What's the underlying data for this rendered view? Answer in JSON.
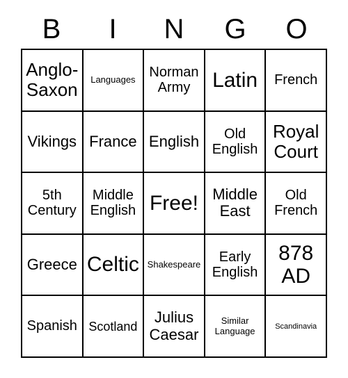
{
  "header": {
    "letters": [
      "B",
      "I",
      "N",
      "G",
      "O"
    ]
  },
  "grid": {
    "rows": [
      [
        {
          "text": "Anglo-Saxon",
          "size": "fs-xl"
        },
        {
          "text": "Languages",
          "size": "fs-xs"
        },
        {
          "text": "Norman Army",
          "size": "fs-md"
        },
        {
          "text": "Latin",
          "size": "fs-xxl"
        },
        {
          "text": "French",
          "size": "fs-md"
        }
      ],
      [
        {
          "text": "Vikings",
          "size": "fs-lg"
        },
        {
          "text": "France",
          "size": "fs-lg"
        },
        {
          "text": "English",
          "size": "fs-lg"
        },
        {
          "text": "Old English",
          "size": "fs-md"
        },
        {
          "text": "Royal Court",
          "size": "fs-xl"
        }
      ],
      [
        {
          "text": "5th Century",
          "size": "fs-md"
        },
        {
          "text": "Middle English",
          "size": "fs-md"
        },
        {
          "text": "Free!",
          "size": "fs-xxl"
        },
        {
          "text": "Middle East",
          "size": "fs-lg"
        },
        {
          "text": "Old French",
          "size": "fs-md"
        }
      ],
      [
        {
          "text": "Greece",
          "size": "fs-lg"
        },
        {
          "text": "Celtic",
          "size": "fs-xxl"
        },
        {
          "text": "Shakespeare",
          "size": "fs-xs"
        },
        {
          "text": "Early English",
          "size": "fs-md"
        },
        {
          "text": "878 AD",
          "size": "fs-xxl"
        }
      ],
      [
        {
          "text": "Spanish",
          "size": "fs-md"
        },
        {
          "text": "Scotland",
          "size": "fs-sm"
        },
        {
          "text": "Julius Caesar",
          "size": "fs-lg"
        },
        {
          "text": "Similar Language",
          "size": "fs-xs"
        },
        {
          "text": "Scandinavia",
          "size": "fs-xxs"
        }
      ]
    ]
  },
  "colors": {
    "background": "#ffffff",
    "text": "#000000",
    "grid_line": "#000000"
  }
}
